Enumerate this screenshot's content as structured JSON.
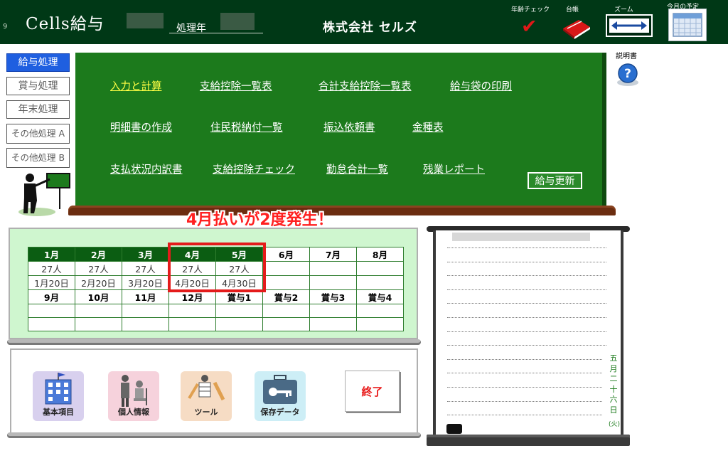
{
  "header": {
    "row_number": "9",
    "app_title": "Cells給与",
    "year_label": "処理年",
    "company": "株式会社 セルズ",
    "icons": [
      {
        "label": "年齢チェック",
        "icon": "checkmark-icon"
      },
      {
        "label": "台帳",
        "icon": "ledger-book-icon"
      },
      {
        "label": "ズーム",
        "icon": "zoom-icon"
      },
      {
        "label": "今月の予定",
        "icon": "calendar-icon"
      }
    ]
  },
  "left_menu": [
    {
      "label": "給与処理",
      "active": true
    },
    {
      "label": "賞与処理",
      "active": false
    },
    {
      "label": "年末処理",
      "active": false
    },
    {
      "label": "その他処理 A",
      "active": false
    },
    {
      "label": "その他処理 B",
      "active": false
    }
  ],
  "help": {
    "label": "説明書",
    "icon": "question-icon"
  },
  "board": {
    "rows": [
      [
        "入力と計算",
        "支給控除一覧表",
        "合計支給控除一覧表",
        "給与袋の印刷"
      ],
      [
        "明細書の作成",
        "住民税納付一覧",
        "振込依頼書",
        "金種表"
      ],
      [
        "支払状況内訳書",
        "支給控除チェック",
        "勤怠合計一覧",
        "残業レポート"
      ]
    ],
    "update_button": "給与更新"
  },
  "notice": "4月払いが2度発生！",
  "schedule": {
    "row1_headers": [
      "1月",
      "2月",
      "3月",
      "4月",
      "5月",
      "6月",
      "7月",
      "8月"
    ],
    "row1_counts": [
      "27人",
      "27人",
      "27人",
      "27人",
      "27人",
      "",
      "",
      ""
    ],
    "row1_dates": [
      "1月20日",
      "2月20日",
      "3月20日",
      "4月20日",
      "4月30日",
      "",
      "",
      ""
    ],
    "row2_headers": [
      "9月",
      "10月",
      "11月",
      "12月",
      "賞与1",
      "賞与2",
      "賞与3",
      "賞与4"
    ],
    "row2_counts": [
      "",
      "",
      "",
      "",
      "",
      "",
      "",
      ""
    ],
    "row2_dates": [
      "",
      "",
      "",
      "",
      "",
      "",
      "",
      ""
    ]
  },
  "tools": [
    {
      "label": "基本項目",
      "icon": "building-icon"
    },
    {
      "label": "個人情報",
      "icon": "people-icon"
    },
    {
      "label": "ツール",
      "icon": "tools-icon"
    },
    {
      "label": "保存データ",
      "icon": "briefcase-key-icon"
    }
  ],
  "end_button": "終了",
  "notepad": {
    "date_chars": [
      "五",
      "月",
      "二",
      "十",
      "六",
      "日",
      "(火)"
    ]
  },
  "colors": {
    "header_bg": "#003816",
    "board_green": "#1c7a1c",
    "highlight_red": "#e41b1b",
    "active_blue": "#1f5fe0",
    "schedule_bg": "#cff6cf"
  }
}
